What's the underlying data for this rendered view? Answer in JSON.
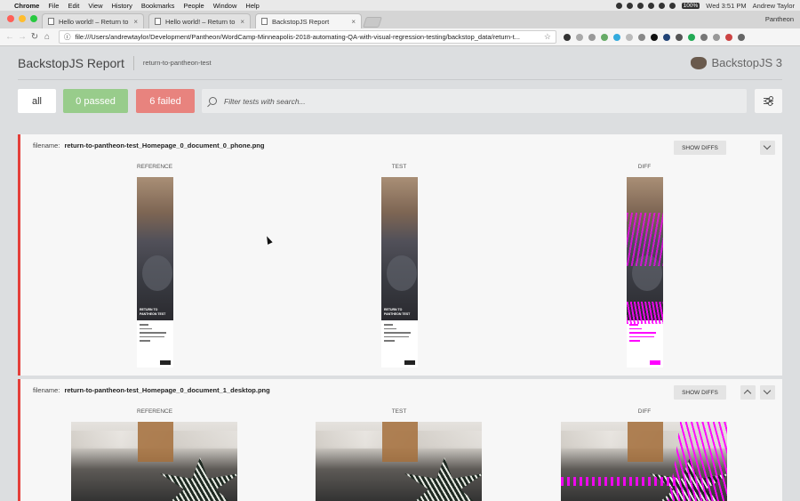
{
  "menubar": {
    "app": "Chrome",
    "items": [
      "File",
      "Edit",
      "View",
      "History",
      "Bookmarks",
      "People",
      "Window",
      "Help"
    ],
    "battery": "100%",
    "clock": "Wed 3:51 PM",
    "user": "Andrew Taylor"
  },
  "tabs": [
    {
      "title": "Hello world! – Return to Panthe"
    },
    {
      "title": "Hello world! – Return to Panthe"
    },
    {
      "title": "BackstopJS Report"
    }
  ],
  "profile": "Pantheon",
  "address": {
    "url": "file:///Users/andrewtaylor/Development/Pantheon/WordCamp-Minneapolis-2018-automating-QA-with-visual-regression-testing/backstop_data/return-t..."
  },
  "report": {
    "title": "BackstopJS Report",
    "project": "return-to-pantheon-test",
    "brand": "BackstopJS 3"
  },
  "filters": {
    "all": "all",
    "passed": "0 passed",
    "failed": "6 failed",
    "search_placeholder": "Filter tests with search..."
  },
  "tests": [
    {
      "filename_label": "filename:",
      "filename": "return-to-pantheon-test_Homepage_0_document_0_phone.png",
      "show_diffs": "SHOW DIFFS",
      "cols": [
        "REFERENCE",
        "TEST",
        "DIFF"
      ],
      "hero_text": "RETURN TO PANTHEON TEST"
    },
    {
      "filename_label": "filename:",
      "filename": "return-to-pantheon-test_Homepage_0_document_1_desktop.png",
      "show_diffs": "SHOW DIFFS",
      "cols": [
        "REFERENCE",
        "TEST",
        "DIFF"
      ]
    }
  ],
  "colors": {
    "failed": "#e8837e",
    "passed": "#98cc8b",
    "fail_border": "#e43f3a",
    "diff_highlight": "#ff00ff"
  }
}
